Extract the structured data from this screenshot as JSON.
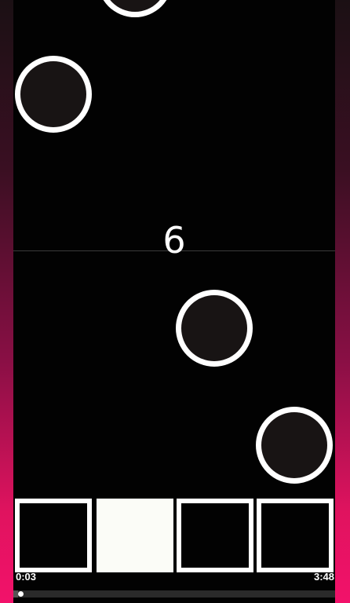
{
  "game": {
    "score": "6"
  },
  "lanes": {
    "count": 4,
    "active_index": 1
  },
  "playback": {
    "elapsed": "0:03",
    "total": "3:48",
    "progress_fraction": 0.014
  },
  "colors": {
    "accent": "#f2126a",
    "note_ring": "#ffffff",
    "note_fill": "#181414",
    "background": "#020202"
  }
}
